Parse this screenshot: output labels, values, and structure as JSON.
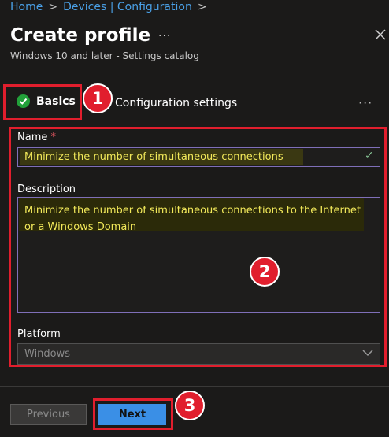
{
  "breadcrumb": {
    "items": [
      "Home",
      "Devices | Configuration"
    ]
  },
  "header": {
    "title": "Create profile",
    "more": "···",
    "subtitle": "Windows 10 and later - Settings catalog"
  },
  "steps": [
    {
      "label": "Basics",
      "status": "completed",
      "icon": "check-circle-icon"
    },
    {
      "label": "Configuration settings"
    }
  ],
  "steps_more": "···",
  "form": {
    "name": {
      "label": "Name",
      "required_mark": "*",
      "value": "Minimize the number of simultaneous connections"
    },
    "description": {
      "label": "Description",
      "value": "Minimize the number of simultaneous connections to the Internet or a Windows Domain"
    },
    "platform": {
      "label": "Platform",
      "value": "Windows"
    }
  },
  "footer": {
    "previous_label": "Previous",
    "next_label": "Next"
  },
  "annotations": {
    "callout_1": "1",
    "callout_2": "2",
    "callout_3": "3"
  },
  "colors": {
    "accent": "#3a8fe6",
    "callout": "#e11e2d",
    "success": "#22a03a",
    "highlight_text": "#f2e95a"
  }
}
